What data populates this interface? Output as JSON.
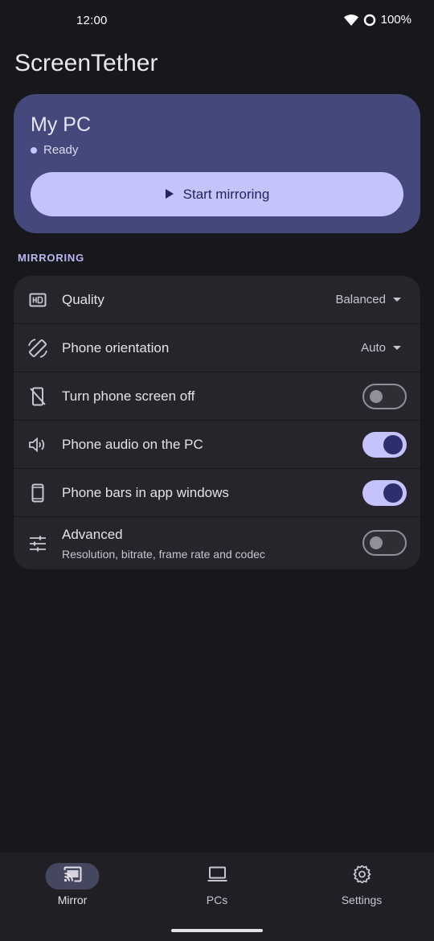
{
  "status_bar": {
    "time": "12:00",
    "battery": "100%"
  },
  "app": {
    "title": "ScreenTether"
  },
  "device_card": {
    "name": "My PC",
    "status": "Ready",
    "start_button_label": "Start mirroring"
  },
  "section": {
    "label": "MIRRORING"
  },
  "settings": [
    {
      "label": "Quality",
      "icon": "hd-icon",
      "control": "dropdown",
      "value": "Balanced"
    },
    {
      "label": "Phone orientation",
      "icon": "screen-rotation-icon",
      "control": "dropdown",
      "value": "Auto"
    },
    {
      "label": "Turn phone screen off",
      "icon": "mobile-off-icon",
      "control": "toggle",
      "checked": false
    },
    {
      "label": "Phone audio on the PC",
      "icon": "volume-icon",
      "control": "toggle",
      "checked": true
    },
    {
      "label": "Phone bars in app windows",
      "icon": "smartphone-icon",
      "control": "toggle",
      "checked": true
    },
    {
      "label": "Advanced",
      "sublabel": "Resolution, bitrate, frame rate and codec",
      "icon": "tune-icon",
      "control": "toggle",
      "checked": false
    }
  ],
  "bottom_nav": {
    "items": [
      {
        "label": "Mirror",
        "icon": "cast-icon",
        "active": true
      },
      {
        "label": "PCs",
        "icon": "laptop-icon",
        "active": false
      },
      {
        "label": "Settings",
        "icon": "gear-icon",
        "active": false
      }
    ]
  },
  "colors": {
    "background": "#18171c",
    "card": "#44487a",
    "accent": "#c4c3fb",
    "row": "#26252b"
  }
}
